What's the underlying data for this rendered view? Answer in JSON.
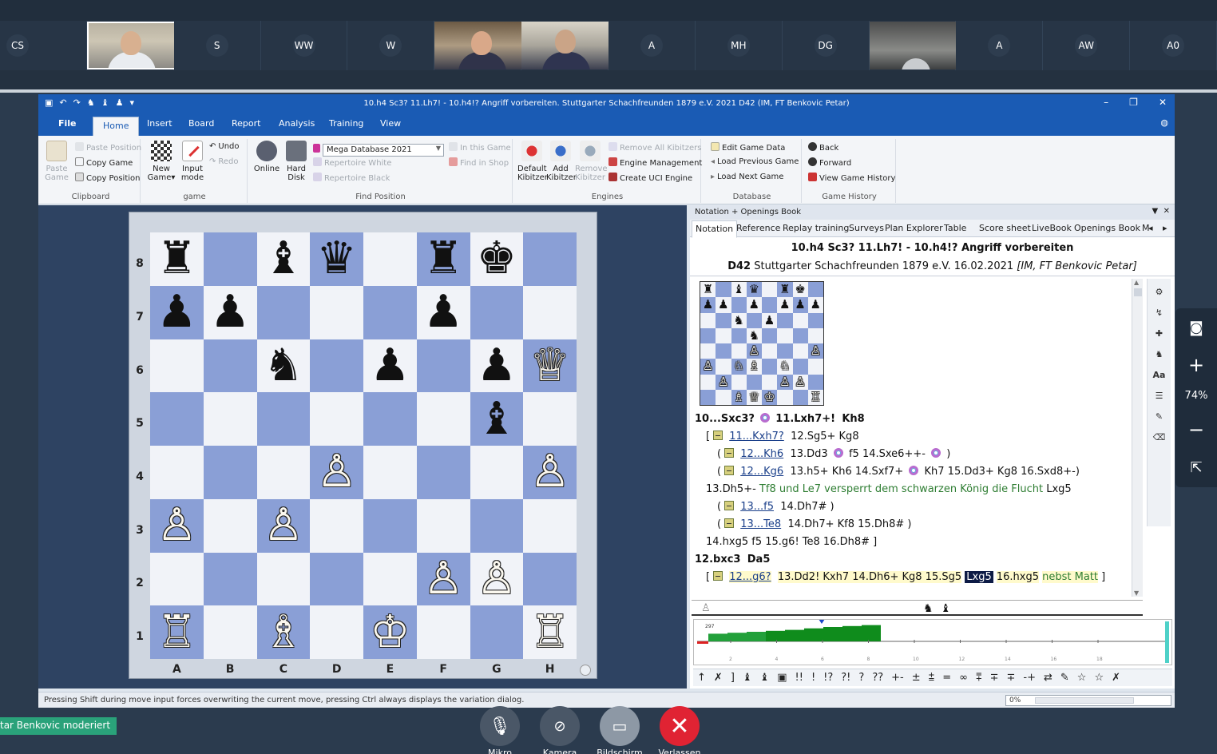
{
  "participants": [
    "CS",
    "",
    "S",
    "WW",
    "W",
    "",
    "",
    "A",
    "MH",
    "DG",
    "",
    "A",
    "AW",
    "A0"
  ],
  "window": {
    "title": "10.h4 Sc3? 11.Lh7! - 10.h4!? Angriff vorbereiten. Stuttgarter Schachfreunden 1879 e.V. 2021  D42  (IM, FT Benkovic Petar)"
  },
  "ribbon_tabs": [
    "File",
    "Home",
    "Insert",
    "Board",
    "Report",
    "Analysis",
    "Training",
    "View"
  ],
  "ribbon": {
    "clipboard": {
      "paste_game": "Paste\nGame",
      "paste_position": "Paste Position",
      "copy_game": "Copy Game",
      "copy_position": "Copy Position",
      "label": "Clipboard"
    },
    "game": {
      "new_game": "New\nGame▾",
      "input_mode": "Input\nmode",
      "undo": "Undo",
      "redo": "Redo",
      "label": "game"
    },
    "find": {
      "online": "Online",
      "hard_disk": "Hard\nDisk",
      "database": "Mega Database 2021",
      "rep_white": "Repertoire White",
      "rep_black": "Repertoire Black",
      "in_this_game": "In this Game",
      "find_in_shop": "Find in Shop",
      "label": "Find Position"
    },
    "engines": {
      "default_kibitzer": "Default\nKibitzer",
      "add_kibitzer": "Add\nKibitzer",
      "remove_kibitzer": "Remove\nKibitzer",
      "remove_all": "Remove All Kibitzers",
      "engine_mgmt": "Engine Management",
      "create_uci": "Create UCI Engine",
      "label": "Engines"
    },
    "database": {
      "edit": "Edit Game Data",
      "load_prev": "Load Previous Game",
      "load_next": "Load Next Game",
      "label": "Database"
    },
    "history": {
      "back": "Back",
      "forward": "Forward",
      "view": "View Game History",
      "label": "Game History"
    }
  },
  "board": {
    "ranks": [
      "8",
      "7",
      "6",
      "5",
      "4",
      "3",
      "2",
      "1"
    ],
    "files": [
      "A",
      "B",
      "C",
      "D",
      "E",
      "F",
      "G",
      "H"
    ],
    "position": [
      [
        "♜",
        "",
        "♝",
        "♛",
        "",
        "♜",
        "♚",
        ""
      ],
      [
        "♟",
        "♟",
        "",
        "",
        "",
        "♟",
        "",
        ""
      ],
      [
        "",
        "",
        "♞",
        "",
        "♟",
        "",
        "♟",
        "♕"
      ],
      [
        "",
        "",
        "",
        "",
        "",
        "",
        "♝",
        ""
      ],
      [
        "",
        "",
        "",
        "♙",
        "",
        "",
        "",
        "♙"
      ],
      [
        "♙",
        "",
        "♙",
        "",
        "",
        "",
        "",
        ""
      ],
      [
        "",
        "",
        "",
        "",
        "",
        "♙",
        "♙",
        ""
      ],
      [
        "♖",
        "",
        "♗",
        "",
        "♔",
        "",
        "",
        "♖"
      ]
    ],
    "white_pieces": [
      "♔",
      "♕",
      "♖",
      "♗",
      "♘",
      "♙"
    ]
  },
  "panel": {
    "header": "Notation + Openings Book",
    "tabs": [
      "Notation",
      "Reference",
      "Replay training",
      "Surveys",
      "Plan Explorer",
      "Table",
      "Score sheet",
      "LiveBook",
      "Openings Book",
      "M"
    ],
    "game_title": "10.h4 Sc3? 11.Lh7! - 10.h4!? Angriff vorbereiten",
    "eco": "D42",
    "event": "Stuttgarter Schachfreunden 1879 e.V. 16.02.2021",
    "players": "[IM, FT Benkovic Petar]"
  },
  "miniboard": [
    [
      "♜",
      "",
      "♝",
      "♛",
      "",
      "♜",
      "♚",
      ""
    ],
    [
      "♟",
      "♟",
      "",
      "♟",
      "",
      "♟",
      "♟",
      "♟"
    ],
    [
      "",
      "",
      "♞",
      "",
      "♟",
      "",
      "",
      ""
    ],
    [
      "",
      "",
      "",
      "♞",
      "",
      "",
      "",
      ""
    ],
    [
      "",
      "",
      "",
      "♙",
      "",
      "",
      "",
      "♙"
    ],
    [
      "♙",
      "",
      "♘",
      "♗",
      "",
      "♘",
      "",
      ""
    ],
    [
      "",
      "♙",
      "",
      "",
      "",
      "♙",
      "♙",
      ""
    ],
    [
      "",
      "",
      "♗",
      "♕",
      "♔",
      "",
      "",
      "♖"
    ]
  ],
  "notation": {
    "l1_a": "10...Sxc3?",
    "l1_b": "11.Lxh7+!",
    "l1_c": "Kh8",
    "l2_a": "11...Kxh7?",
    "l2_b": "12.Sg5+ Kg8",
    "l3_a": "12...Kh6",
    "l3_b": "13.Dd3",
    "l3_c": "f5  14.Sxe6++-",
    "l3_d": ")",
    "l4_a": "12...Kg6",
    "l4_b": "13.h5+ Kh6  14.Sxf7+",
    "l4_c": "Kh7  15.Dd3+ Kg8  16.Sxd8+-)",
    "l5_a": "13.Dh5+-",
    "l5_b": "Tf8 und Le7 versperrt dem schwarzen König die Flucht",
    "l5_c": "Lxg5",
    "l6_a": "13...f5",
    "l6_b": "14.Dh7# )",
    "l7_a": "13...Te8",
    "l7_b": "14.Dh7+ Kf8  15.Dh8# )",
    "l8": "14.hxg5  f5  15.g6! Te8  16.Dh8# ]",
    "l9_a": "12.bxc3",
    "l9_b": "Da5",
    "l10_a": "12...g6?",
    "l10_b": "13.Dd2! Kxh7  14.Dh6+ Kg8  15.Sg5",
    "l10_c": "Lxg5",
    "l10_d": "16.hxg5",
    "l10_e": "nebst Matt",
    "l10_f": "]"
  },
  "eval": {
    "label": "297",
    "values": [
      0.4,
      0.45,
      0.5,
      0.55,
      0.6,
      0.68,
      0.75,
      0.8,
      0.85
    ],
    "ticks": [
      "2",
      "4",
      "6",
      "8",
      "10",
      "12",
      "14",
      "16",
      "18"
    ]
  },
  "symbols": [
    "↑",
    "✗",
    "]",
    "♝",
    "♝",
    "▣",
    "!!",
    "!",
    "!?",
    "?!",
    "?",
    "??",
    "+-",
    "±",
    "⩲",
    "=",
    "∞",
    "⩱",
    "∓",
    "∓",
    "-+",
    "⇄",
    "✎",
    "☆",
    "☆",
    "✗"
  ],
  "status": {
    "text": "Pressing Shift during move input forces overwriting the current move, pressing Ctrl always displays the variation dialog.",
    "progress": "0%"
  },
  "zoom": {
    "level": "74%"
  },
  "moderator": "tar Benkovic moderiert",
  "controls": [
    "Mikro",
    "Kamera",
    "Bildschirm",
    "Verlassen"
  ]
}
